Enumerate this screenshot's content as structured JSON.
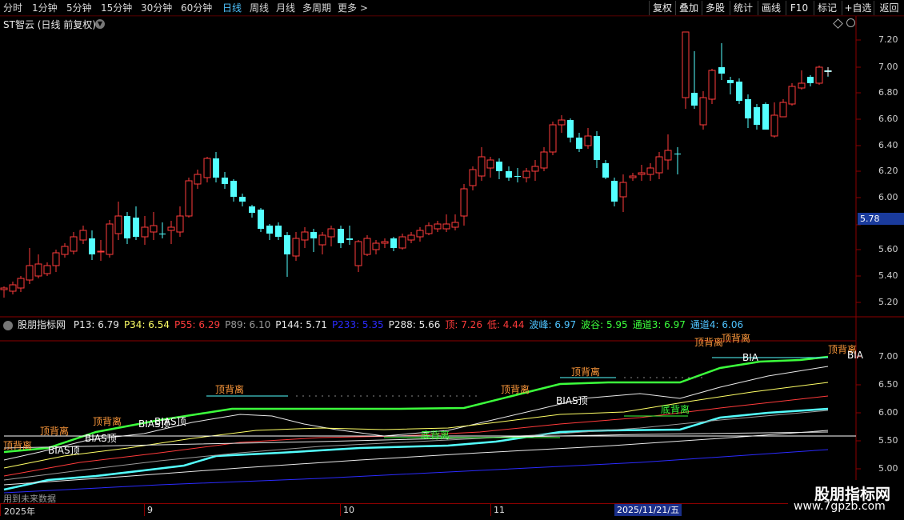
{
  "toolbar": {
    "timeframes": [
      "分时",
      "1分钟",
      "5分钟",
      "15分钟",
      "30分钟",
      "60分钟",
      "日线",
      "周线",
      "月线",
      "多周期"
    ],
    "active": "日线",
    "more": "更多 >",
    "right_buttons": [
      "复权",
      "叠加",
      "多股",
      "统计",
      "画线",
      "F10",
      "标记",
      "+自选",
      "返回"
    ]
  },
  "main_chart": {
    "title": "ST智云 (日线 前复权)",
    "y_ticks": [
      "7.20",
      "7.00",
      "6.80",
      "6.60",
      "6.40",
      "6.20",
      "6.00",
      "5.80",
      "5.60",
      "5.40",
      "5.20"
    ],
    "current_price": "5.78"
  },
  "indicator": {
    "name": "股朋指标网",
    "items": [
      {
        "text": "P13: 6.79",
        "color": "#e8e8e8"
      },
      {
        "text": "P34: 6.54",
        "color": "#ffff66"
      },
      {
        "text": "P55: 6.29",
        "color": "#ff3b3b"
      },
      {
        "text": "P89: 6.10",
        "color": "#9a9a9a"
      },
      {
        "text": "P144: 5.71",
        "color": "#e8e8e8"
      },
      {
        "text": "P233: 5.35",
        "color": "#2b2bff"
      },
      {
        "text": "P288: 5.66",
        "color": "#e8e8e8"
      },
      {
        "text": "顶: 7.26",
        "color": "#ff3b3b"
      },
      {
        "text": "低: 4.44",
        "color": "#ff3b3b"
      },
      {
        "text": "波峰: 6.97",
        "color": "#4fc3ff"
      },
      {
        "text": "波谷: 5.95",
        "color": "#3cff3c"
      },
      {
        "text": "通道3: 6.97",
        "color": "#3cff3c"
      },
      {
        "text": "通道4: 6.06",
        "color": "#4fc3ff"
      }
    ],
    "y_ticks": [
      "7.00",
      "6.50",
      "6.00",
      "5.50",
      "5.00"
    ],
    "annotations": [
      {
        "text": "顶背离",
        "color": "#ff9a3c"
      },
      {
        "text": "顶背离",
        "color": "#ff9a3c"
      },
      {
        "text": "顶背离",
        "color": "#ff9a3c"
      },
      {
        "text": "顶背离",
        "color": "#ff9a3c"
      },
      {
        "text": "顶背离",
        "color": "#ff9a3c"
      },
      {
        "text": "顶背离",
        "color": "#ff9a3c"
      },
      {
        "text": "顶背离",
        "color": "#ff9a3c"
      },
      {
        "text": "顶背离",
        "color": "#ff9a3c"
      },
      {
        "text": "顶背离",
        "color": "#ff9a3c"
      },
      {
        "text": "底背离",
        "color": "#3cff3c"
      },
      {
        "text": "底背离",
        "color": "#3cff3c"
      },
      {
        "text": "BIAS顶",
        "color": "#ffffff"
      },
      {
        "text": "BIAS顶",
        "color": "#ffffff"
      },
      {
        "text": "BIAS顶",
        "color": "#ffffff"
      },
      {
        "text": "BIAS顶",
        "color": "#ffffff"
      },
      {
        "text": "BIAS顶",
        "color": "#ffffff"
      },
      {
        "text": "BIA",
        "color": "#ffffff"
      }
    ]
  },
  "date_axis": {
    "labels": [
      "2025年",
      "9",
      "10",
      "11"
    ],
    "cursor": "2025/11/21/五",
    "future_note": "用到未来数据"
  },
  "watermark": {
    "line1": "股朋指标网",
    "line2": "www.7gpzb.com"
  },
  "colors": {
    "up": "#ff3b3b",
    "down": "#54ffff",
    "grid": "#8b0000"
  }
}
